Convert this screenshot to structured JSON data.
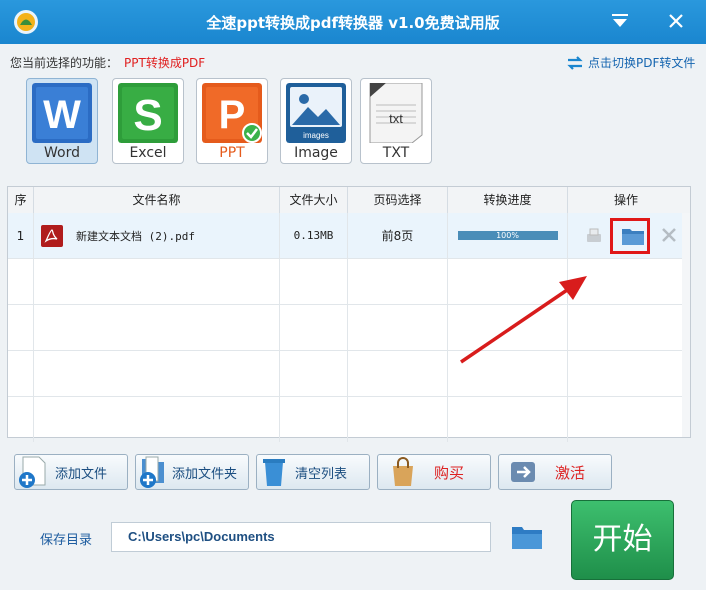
{
  "window": {
    "title": "全速ppt转换成pdf转换器 v1.0免费试用版"
  },
  "function_bar": {
    "label": "您当前选择的功能：",
    "value": "PPT转换成PDF",
    "switch_link": "点击切换PDF转文件"
  },
  "formats": [
    {
      "label": "Word",
      "color": "#2b6cc4",
      "selected": true
    },
    {
      "label": "Excel",
      "color": "#2e9d3a",
      "selected": false
    },
    {
      "label": "PPT",
      "color": "#e55b1c",
      "selected": false,
      "checked": true
    },
    {
      "label": "Image",
      "color": "#2a6aa8",
      "selected": false,
      "icon_text": "images"
    },
    {
      "label": "TXT",
      "color": "#555555",
      "selected": false,
      "icon_text": "txt"
    }
  ],
  "table": {
    "headers": [
      "序",
      "文件名称",
      "文件大小",
      "页码选择",
      "转换进度",
      "操作"
    ],
    "rows": [
      {
        "index": "1",
        "name": "新建文本文档 (2).pdf",
        "size": "0.13MB",
        "pages": "前8页",
        "progress": "100%",
        "progress_value": 100
      }
    ]
  },
  "buttons": {
    "add_file": "添加文件",
    "add_folder": "添加文件夹",
    "clear_list": "清空列表",
    "buy": "购买",
    "activate": "激活"
  },
  "save": {
    "label": "保存目录",
    "path": "C:\\Users\\pc\\Documents"
  },
  "start": {
    "label": "开始"
  },
  "colors": {
    "accent": "#1a86cf",
    "start": "#2aa85a",
    "highlight": "#e01818"
  }
}
